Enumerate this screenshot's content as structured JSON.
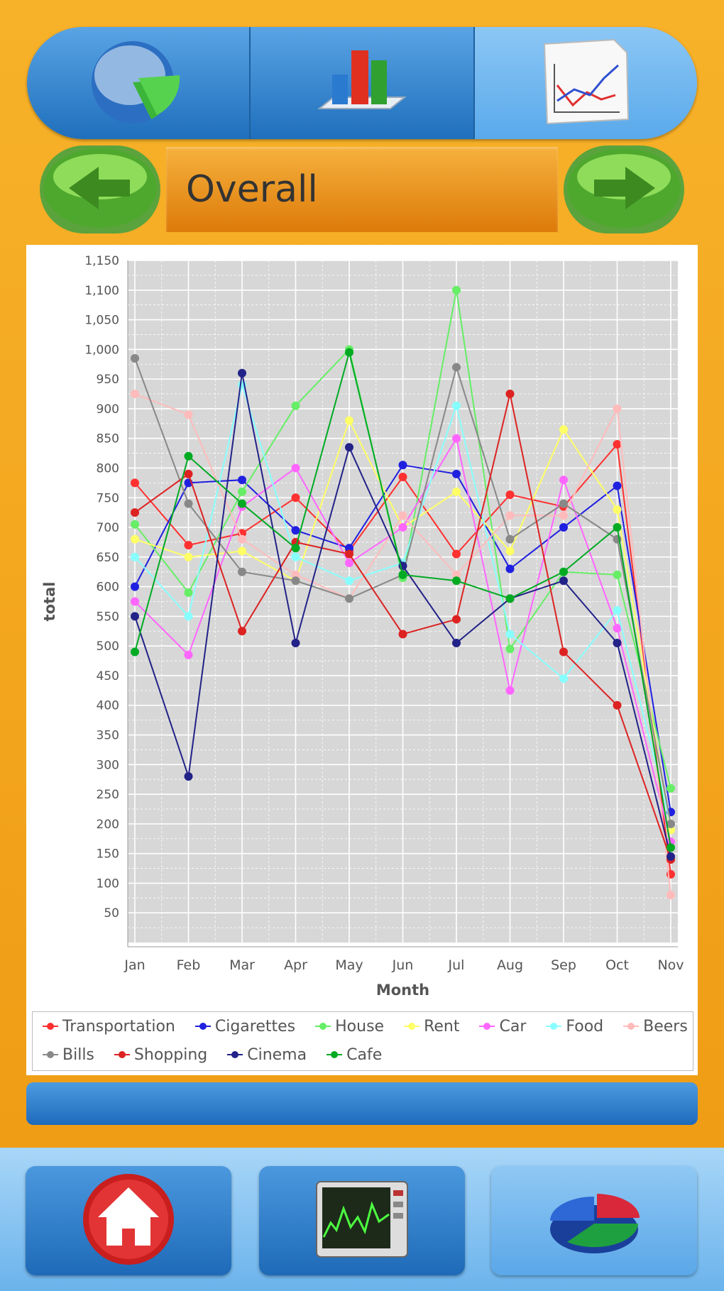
{
  "tabs": [
    {
      "icon": "pie-chart-icon",
      "active": false
    },
    {
      "icon": "bar-chart-icon",
      "active": false
    },
    {
      "icon": "line-chart-icon",
      "active": true
    }
  ],
  "nav": {
    "title": "Overall",
    "prev_icon": "arrow-left-icon",
    "next_icon": "arrow-right-icon"
  },
  "toolbar": [
    {
      "icon": "home-icon"
    },
    {
      "icon": "monitor-chart-icon"
    },
    {
      "icon": "3d-pie-chart-icon"
    }
  ],
  "chart_data": {
    "type": "line",
    "title": "",
    "xlabel": "Month",
    "ylabel": "total",
    "ylim": [
      0,
      1150
    ],
    "yticks": [
      50,
      100,
      150,
      200,
      250,
      300,
      350,
      400,
      450,
      500,
      550,
      600,
      650,
      700,
      750,
      800,
      850,
      900,
      950,
      1000,
      1050,
      1100,
      1150
    ],
    "ytick_labels": [
      "50",
      "100",
      "150",
      "200",
      "250",
      "300",
      "350",
      "400",
      "450",
      "500",
      "550",
      "600",
      "650",
      "700",
      "750",
      "800",
      "850",
      "900",
      "950",
      "1,000",
      "1,050",
      "1,100",
      "1,150"
    ],
    "categories": [
      "Jan",
      "Feb",
      "Mar",
      "Apr",
      "May",
      "Jun",
      "Jul",
      "Aug",
      "Sep",
      "Oct",
      "Nov"
    ],
    "grid": true,
    "legend_position": "bottom",
    "series": [
      {
        "name": "Transportation",
        "color": "#ff3030",
        "values": [
          775,
          670,
          690,
          750,
          660,
          785,
          655,
          755,
          735,
          840,
          115
        ]
      },
      {
        "name": "Cigarettes",
        "color": "#2020e0",
        "values": [
          600,
          775,
          780,
          695,
          665,
          805,
          790,
          630,
          700,
          770,
          220
        ]
      },
      {
        "name": "House",
        "color": "#66ee66",
        "values": [
          705,
          590,
          760,
          905,
          1000,
          615,
          1100,
          495,
          625,
          620,
          260
        ]
      },
      {
        "name": "Rent",
        "color": "#ffff66",
        "values": [
          680,
          650,
          660,
          610,
          880,
          700,
          760,
          660,
          865,
          730,
          190
        ]
      },
      {
        "name": "Car",
        "color": "#ff66ff",
        "values": [
          575,
          485,
          735,
          800,
          640,
          700,
          850,
          425,
          780,
          530,
          170
        ]
      },
      {
        "name": "Food",
        "color": "#88ffff",
        "values": [
          650,
          550,
          940,
          650,
          610,
          640,
          905,
          520,
          445,
          560,
          200
        ]
      },
      {
        "name": "Beers",
        "color": "#ffbbbb",
        "values": [
          925,
          890,
          680,
          620,
          580,
          720,
          620,
          720,
          720,
          900,
          80
        ]
      },
      {
        "name": "Bills",
        "color": "#888888",
        "values": [
          985,
          740,
          625,
          610,
          580,
          620,
          970,
          680,
          740,
          680,
          200
        ]
      },
      {
        "name": "Shopping",
        "color": "#dd2222",
        "values": [
          725,
          790,
          525,
          675,
          655,
          520,
          545,
          925,
          490,
          400,
          140
        ]
      },
      {
        "name": "Cinema",
        "color": "#222288",
        "values": [
          550,
          280,
          960,
          505,
          835,
          635,
          505,
          580,
          610,
          505,
          145
        ]
      },
      {
        "name": "Cafe",
        "color": "#00aa22",
        "values": [
          490,
          820,
          740,
          665,
          995,
          620,
          610,
          580,
          625,
          700,
          160
        ]
      }
    ]
  }
}
